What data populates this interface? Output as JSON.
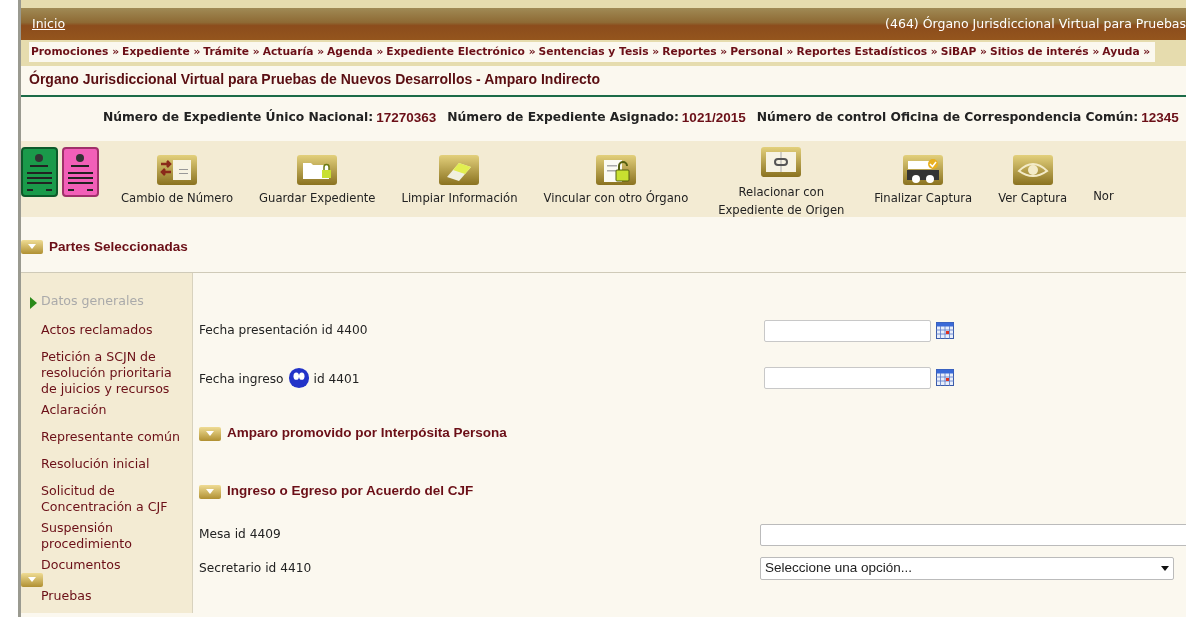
{
  "header": {
    "home_link": "Inicio",
    "org_title": "(464) Órgano Jurisdiccional Virtual para Pruebas"
  },
  "menu": [
    "Promociones »",
    "Expediente »",
    "Trámite »",
    "Actuaría »",
    "Agenda »",
    "Expediente Electrónico »",
    "Sentencias y Tesis »",
    "Reportes »",
    "Personal »",
    "Reportes Estadísticos »",
    "SiBAP »",
    "Sitios de interés »",
    "Ayuda »"
  ],
  "page_title": "Órgano Jurisdiccional Virtual para Pruebas de Nuevos Desarrollos - Amparo Indirecto",
  "info": [
    {
      "label": "Número de Expediente Único Nacional:",
      "value": "17270363"
    },
    {
      "label": "Número de Expediente Asignado:",
      "value": "1021/2015"
    },
    {
      "label": "Número de control Oficina de Correspondencia Común:",
      "value": "12345"
    }
  ],
  "toolbar": [
    {
      "kind": "green-doc"
    },
    {
      "kind": "pink-doc"
    },
    {
      "kind": "number",
      "label": "Cambio de Número"
    },
    {
      "kind": "folder-lock",
      "label": "Guardar Expediente"
    },
    {
      "kind": "eraser",
      "label": "Limpiar Información"
    },
    {
      "kind": "unlock",
      "label": "Vincular con otro Órgano"
    },
    {
      "kind": "link",
      "label": "Relacionar con Expediente de Origen"
    },
    {
      "kind": "keyboard",
      "label": "Finalizar Captura"
    },
    {
      "kind": "eye",
      "label": "Ver Captura"
    },
    {
      "kind": "none",
      "label": "Nor"
    }
  ],
  "parties_section": "Partes Seleccionadas",
  "sidebar": [
    {
      "label": "Datos generales",
      "selected": true
    },
    {
      "label": "Actos reclamados",
      "selected": false
    },
    {
      "label": "Petición a SCJN de resolución prioritaria de juicios y recursos",
      "selected": false
    },
    {
      "label": "Aclaración",
      "selected": false
    },
    {
      "label": "Representante común",
      "selected": false
    },
    {
      "label": "Resolución inicial",
      "selected": false
    },
    {
      "label": "Solicitud de Concentración a CJF",
      "selected": false
    },
    {
      "label": "Suspensión procedimiento",
      "selected": false
    },
    {
      "label": "Documentos",
      "selected": false
    },
    {
      "label": "Pruebas",
      "selected": false
    }
  ],
  "form": [
    {
      "kind": "date",
      "label": "Fecha presentación id 4400"
    },
    {
      "kind": "date",
      "label": "Fecha ingreso",
      "help_icon": true,
      "label_suffix": "id 4401"
    },
    {
      "kind": "section",
      "title": "Amparo promovido por Interpósita Persona"
    },
    {
      "kind": "section",
      "title": "Ingreso o Egreso por Acuerdo del CJF"
    },
    {
      "kind": "text",
      "label": "Mesa id 4409"
    },
    {
      "kind": "select",
      "label": "Secretario id 4410",
      "value": "Seleccione una opción..."
    }
  ]
}
